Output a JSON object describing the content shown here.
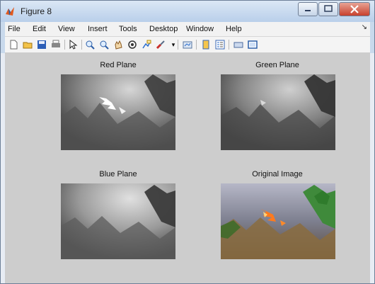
{
  "window": {
    "title": "Figure 8",
    "menu": [
      "File",
      "Edit",
      "View",
      "Insert",
      "Tools",
      "Desktop",
      "Window",
      "Help"
    ]
  },
  "toolbar": {
    "icons": [
      "new-figure-icon",
      "open-file-icon",
      "save-icon",
      "print-icon",
      "pointer-icon",
      "zoom-in-icon",
      "zoom-out-icon",
      "pan-icon",
      "rotate-3d-icon",
      "data-cursor-icon",
      "brush-icon",
      "link-plot-icon",
      "insert-colorbar-icon",
      "insert-legend-icon",
      "hide-plot-tools-icon",
      "show-plot-tools-icon"
    ]
  },
  "panels": [
    {
      "title": "Red Plane"
    },
    {
      "title": "Green Plane"
    },
    {
      "title": "Blue Plane"
    },
    {
      "title": "Original Image"
    }
  ]
}
